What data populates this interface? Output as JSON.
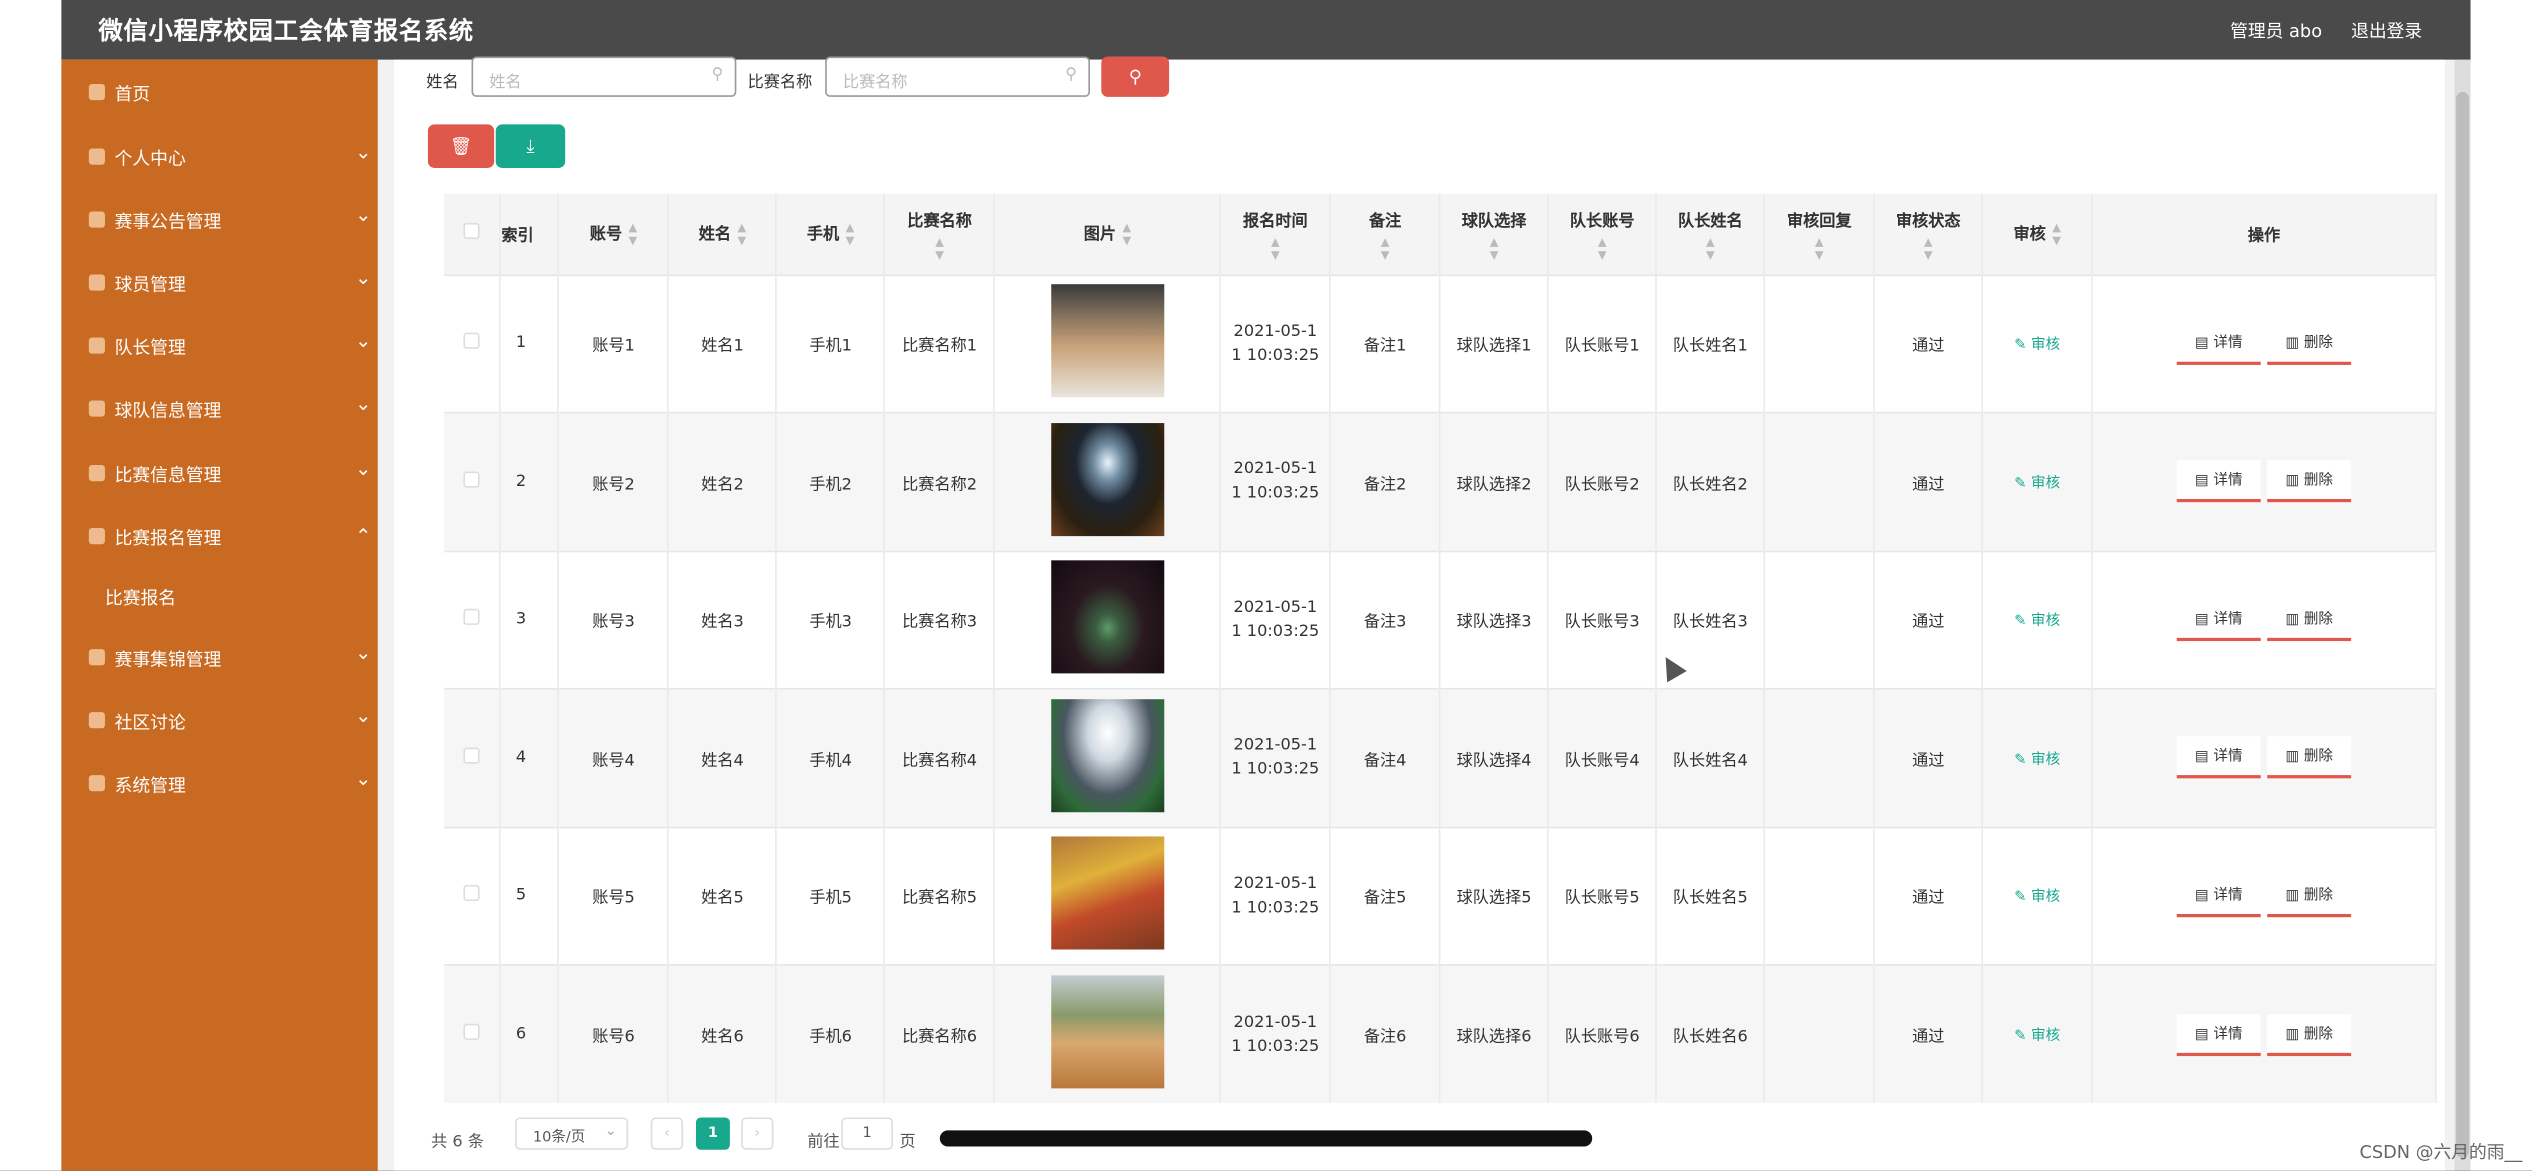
{
  "app": {
    "title": "微信小程序校园工会体育报名系统",
    "admin_label": "管理员 abo",
    "logout_label": "退出登录"
  },
  "sidebar": {
    "items": [
      {
        "label": "首页",
        "has_chevron": false
      },
      {
        "label": "个人中心",
        "has_chevron": true
      },
      {
        "label": "赛事公告管理",
        "has_chevron": true
      },
      {
        "label": "球员管理",
        "has_chevron": true
      },
      {
        "label": "队长管理",
        "has_chevron": true
      },
      {
        "label": "球队信息管理",
        "has_chevron": true
      },
      {
        "label": "比赛信息管理",
        "has_chevron": true
      },
      {
        "label": "比赛报名管理",
        "has_chevron": true,
        "expanded": true
      },
      {
        "label": "赛事集锦管理",
        "has_chevron": true
      },
      {
        "label": "社区讨论",
        "has_chevron": true
      },
      {
        "label": "系统管理",
        "has_chevron": true
      }
    ],
    "sub_item": "比赛报名",
    "chevron_down": "⌄",
    "chevron_up": "⌃"
  },
  "search": {
    "name_label": "姓名",
    "name_placeholder": "姓名",
    "match_label": "比赛名称",
    "match_placeholder": "比赛名称",
    "search_icon": "search-icon"
  },
  "toolbar": {
    "delete_icon": "trash-icon",
    "export_icon": "download-icon"
  },
  "table": {
    "headers": [
      "索引",
      "账号",
      "姓名",
      "手机",
      "比赛名称",
      "图片",
      "报名时间",
      "备注",
      "球队选择",
      "队长账号",
      "队长姓名",
      "审核回复",
      "审核状态",
      "审核",
      "操作"
    ],
    "rows": [
      {
        "index": "1",
        "account": "账号1",
        "name": "姓名1",
        "phone": "手机1",
        "match": "比赛名称1",
        "time_a": "2021-05-1",
        "time_b": "1 10:03:25",
        "note": "备注1",
        "team": "球队选择1",
        "cap_acc": "队长账号1",
        "cap_name": "队长姓名1",
        "reply": "",
        "status": "通过",
        "audit": "审核",
        "detail": "详情",
        "delete": "删除"
      },
      {
        "index": "2",
        "account": "账号2",
        "name": "姓名2",
        "phone": "手机2",
        "match": "比赛名称2",
        "time_a": "2021-05-1",
        "time_b": "1 10:03:25",
        "note": "备注2",
        "team": "球队选择2",
        "cap_acc": "队长账号2",
        "cap_name": "队长姓名2",
        "reply": "",
        "status": "通过",
        "audit": "审核",
        "detail": "详情",
        "delete": "删除"
      },
      {
        "index": "3",
        "account": "账号3",
        "name": "姓名3",
        "phone": "手机3",
        "match": "比赛名称3",
        "time_a": "2021-05-1",
        "time_b": "1 10:03:25",
        "note": "备注3",
        "team": "球队选择3",
        "cap_acc": "队长账号3",
        "cap_name": "队长姓名3",
        "reply": "",
        "status": "通过",
        "audit": "审核",
        "detail": "详情",
        "delete": "删除"
      },
      {
        "index": "4",
        "account": "账号4",
        "name": "姓名4",
        "phone": "手机4",
        "match": "比赛名称4",
        "time_a": "2021-05-1",
        "time_b": "1 10:03:25",
        "note": "备注4",
        "team": "球队选择4",
        "cap_acc": "队长账号4",
        "cap_name": "队长姓名4",
        "reply": "",
        "status": "通过",
        "audit": "审核",
        "detail": "详情",
        "delete": "删除"
      },
      {
        "index": "5",
        "account": "账号5",
        "name": "姓名5",
        "phone": "手机5",
        "match": "比赛名称5",
        "time_a": "2021-05-1",
        "time_b": "1 10:03:25",
        "note": "备注5",
        "team": "球队选择5",
        "cap_acc": "队长账号5",
        "cap_name": "队长姓名5",
        "reply": "",
        "status": "通过",
        "audit": "审核",
        "detail": "详情",
        "delete": "删除"
      },
      {
        "index": "6",
        "account": "账号6",
        "name": "姓名6",
        "phone": "手机6",
        "match": "比赛名称6",
        "time_a": "2021-05-1",
        "time_b": "1 10:03:25",
        "note": "备注6",
        "team": "球队选择6",
        "cap_acc": "队长账号6",
        "cap_name": "队长姓名6",
        "reply": "",
        "status": "通过",
        "audit": "审核",
        "detail": "详情",
        "delete": "删除"
      }
    ]
  },
  "pagination": {
    "total": "共 6 条",
    "page_size": "10条/页",
    "current_page": "1",
    "goto_label": "前往",
    "goto_value": "1",
    "page_suffix": "页"
  },
  "watermark": "CSDN @六月的雨__",
  "colors": {
    "sidebar": "#c96a22",
    "topbar": "#4a4a4a",
    "accent_red": "#e0584c",
    "accent_teal": "#17a88e"
  }
}
